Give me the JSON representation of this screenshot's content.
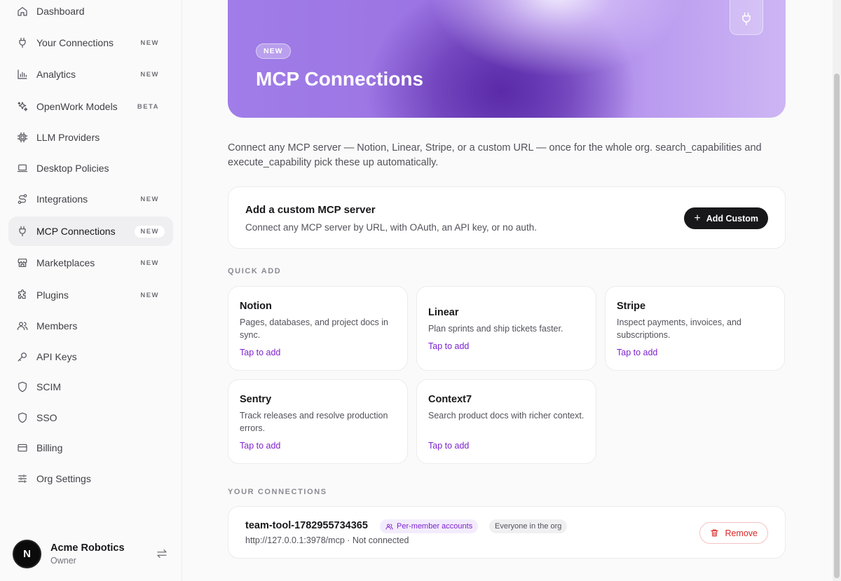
{
  "sidebar": {
    "items": [
      {
        "label": "Dashboard",
        "badge": "",
        "icon": "home-icon"
      },
      {
        "label": "Your Connections",
        "badge": "NEW",
        "icon": "plug-icon"
      },
      {
        "label": "Analytics",
        "badge": "NEW",
        "icon": "bar-chart-icon"
      },
      {
        "label": "OpenWork Models",
        "badge": "BETA",
        "icon": "sparkles-icon"
      },
      {
        "label": "LLM Providers",
        "badge": "",
        "icon": "cpu-icon"
      },
      {
        "label": "Desktop Policies",
        "badge": "",
        "icon": "laptop-icon"
      },
      {
        "label": "Integrations",
        "badge": "NEW",
        "icon": "route-icon"
      },
      {
        "label": "MCP Connections",
        "badge": "NEW",
        "icon": "plug-icon"
      },
      {
        "label": "Marketplaces",
        "badge": "NEW",
        "icon": "store-icon"
      },
      {
        "label": "Plugins",
        "badge": "NEW",
        "icon": "puzzle-icon"
      },
      {
        "label": "Members",
        "badge": "",
        "icon": "users-icon"
      },
      {
        "label": "API Keys",
        "badge": "",
        "icon": "key-icon"
      },
      {
        "label": "SCIM",
        "badge": "",
        "icon": "shield-icon"
      },
      {
        "label": "SSO",
        "badge": "",
        "icon": "shield-icon"
      },
      {
        "label": "Billing",
        "badge": "",
        "icon": "credit-card-icon"
      },
      {
        "label": "Org Settings",
        "badge": "",
        "icon": "sliders-icon"
      }
    ],
    "active_index": 7,
    "org": {
      "avatar_letter": "N",
      "name": "Acme Robotics",
      "role": "Owner"
    }
  },
  "hero": {
    "badge": "NEW",
    "title": "MCP Connections"
  },
  "description": "Connect any MCP server — Notion, Linear, Stripe, or a custom URL — once for the whole org. search_capabilities and execute_capability pick these up automatically.",
  "custom_server": {
    "title": "Add a custom MCP server",
    "subtitle": "Connect any MCP server by URL, with OAuth, an API key, or no auth.",
    "button_label": "Add Custom"
  },
  "quick_add": {
    "label": "QUICK ADD",
    "items": [
      {
        "name": "Notion",
        "description": "Pages, databases, and project docs in sync.",
        "action": "Tap to add"
      },
      {
        "name": "Linear",
        "description": "Plan sprints and ship tickets faster.",
        "action": "Tap to add"
      },
      {
        "name": "Stripe",
        "description": "Inspect payments, invoices, and subscriptions.",
        "action": "Tap to add"
      },
      {
        "name": "Sentry",
        "description": "Track releases and resolve production errors.",
        "action": "Tap to add"
      },
      {
        "name": "Context7",
        "description": "Search product docs with richer context.",
        "action": "Tap to add"
      }
    ]
  },
  "connections": {
    "label": "YOUR CONNECTIONS",
    "items": [
      {
        "name": "team-tool-1782955734365",
        "auth_pill": "Per-member accounts",
        "scope_pill": "Everyone in the org",
        "url_status": "http://127.0.0.1:3978/mcp · Not connected",
        "remove_label": "Remove"
      }
    ]
  },
  "colors": {
    "accent": "#7e22ce",
    "danger": "#dc2626",
    "primary_button": "#18181b"
  }
}
